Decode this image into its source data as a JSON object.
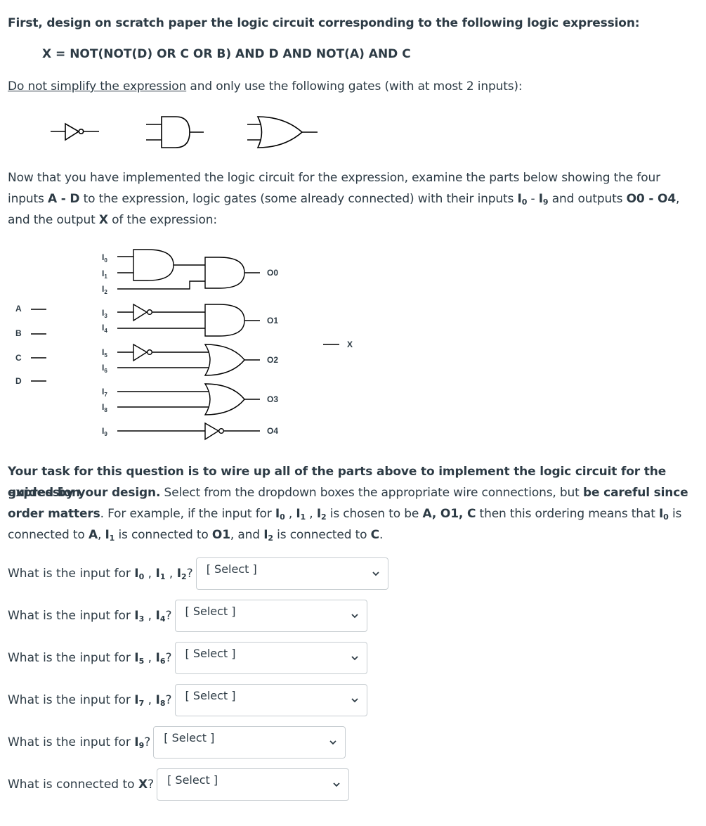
{
  "intro": {
    "line1": "First, design on scratch paper the logic circuit corresponding to the following logic expression:",
    "expression": "X = NOT(NOT(D) OR C OR B) AND D AND NOT(A) AND C",
    "line3_underlined": "Do not simplify the expression",
    "line3_rest": " and only use the following gates (with at most 2 inputs):"
  },
  "gate_legend": [
    "not-gate",
    "and-gate",
    "or-gate"
  ],
  "parts_text": {
    "a": "Now that you have implemented the logic circuit for the expression, examine the parts below showing the four",
    "b1": "inputs ",
    "b_bold1": "A - D",
    "b2": " to the expression, logic gates (some already connected) with their inputs ",
    "b_i0": "I",
    "b_i0_sub": "0",
    "b_dash": " - ",
    "b_i9": "I",
    "b_i9_sub": "9",
    "b3": " and outputs ",
    "b_bold2": "O0 - O4",
    "b4": ",",
    "c1": "and the output ",
    "c_bold": "X",
    "c2": " of the expression:"
  },
  "circuit": {
    "inputs": [
      "A",
      "B",
      "C",
      "D"
    ],
    "gate_inputs": [
      "I",
      "I",
      "I",
      "I",
      "I",
      "I",
      "I",
      "I",
      "I",
      "I"
    ],
    "gate_input_subs": [
      "0",
      "1",
      "2",
      "3",
      "4",
      "5",
      "6",
      "7",
      "8",
      "9"
    ],
    "outputs": [
      "O0",
      "O1",
      "O2",
      "O3",
      "O4"
    ],
    "final_output": "X",
    "gates": [
      {
        "id": "g0a",
        "type": "AND",
        "inputs": [
          "I0",
          "I1"
        ]
      },
      {
        "id": "g0b",
        "type": "AND",
        "inputs": [
          "g0a",
          "I2"
        ],
        "output": "O0"
      },
      {
        "id": "n3",
        "type": "NOT",
        "inputs": [
          "I3"
        ]
      },
      {
        "id": "g1",
        "type": "AND",
        "inputs": [
          "n3",
          "I4"
        ],
        "output": "O1"
      },
      {
        "id": "n5",
        "type": "NOT",
        "inputs": [
          "I5"
        ]
      },
      {
        "id": "g2",
        "type": "OR",
        "inputs": [
          "n5",
          "I6"
        ],
        "output": "O2"
      },
      {
        "id": "g3",
        "type": "OR",
        "inputs": [
          "I7",
          "I8"
        ],
        "output": "O3"
      },
      {
        "id": "n9",
        "type": "NOT",
        "inputs": [
          "I9"
        ],
        "output": "O4"
      }
    ]
  },
  "task_text": {
    "b1": "Your task for this question is to wire up all of the parts above to implement the logic circuit for the expression",
    "b2": "guided by your design.",
    "n1": " Select from the dropdown boxes the appropriate wire connections, but ",
    "b3": "be careful since",
    "b4": "order matters",
    "n2": ". For example, if the input for ",
    "n3": " is chosen to be ",
    "b5": "A, O1, C",
    "n4": " then this ordering means that ",
    "n5": " is",
    "n6": "connected to ",
    "b6": "A",
    "n7": ", ",
    "n8": " is connected to ",
    "b7": "O1",
    "n9": ", and ",
    "n10": " is connected to ",
    "b8": "C",
    "n11": "."
  },
  "questions": [
    {
      "prefix": "What is the input for ",
      "terms": [
        "0",
        "1",
        "2"
      ],
      "suffix": "?",
      "selected": "[ Select ]"
    },
    {
      "prefix": "What is the input for ",
      "terms": [
        "3",
        "4"
      ],
      "suffix": "?",
      "selected": "[ Select ]"
    },
    {
      "prefix": "What is the input for ",
      "terms": [
        "5",
        "6"
      ],
      "suffix": "?",
      "selected": "[ Select ]"
    },
    {
      "prefix": "What is the input for ",
      "terms": [
        "7",
        "8"
      ],
      "suffix": "?",
      "selected": "[ Select ]"
    },
    {
      "prefix": "What is the input for ",
      "terms": [
        "9"
      ],
      "suffix": "?",
      "selected": "[ Select ]"
    },
    {
      "prefix": "What is connected to ",
      "bold": "X",
      "suffix": "?",
      "selected": "[ Select ]"
    }
  ],
  "colors": {
    "text": "#2d3b45",
    "border": "#c7cdd1",
    "wire": "#000000"
  }
}
